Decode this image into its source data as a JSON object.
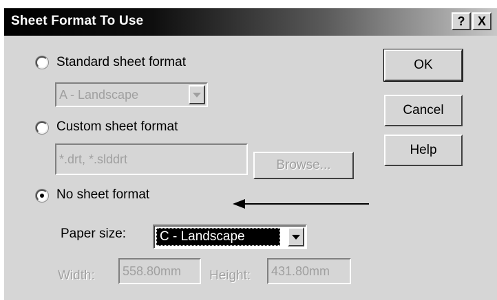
{
  "dialog": {
    "title": "Sheet Format To Use",
    "help_button_label": "?",
    "close_button_label": "X"
  },
  "options": {
    "standard": {
      "label": "Standard sheet format",
      "selected": false,
      "dropdown_value": "A - Landscape"
    },
    "custom": {
      "label": "Custom sheet format",
      "selected": false,
      "file_value": "*.drt, *.slddrt",
      "browse_label": "Browse..."
    },
    "none": {
      "label": "No sheet format",
      "selected": true
    }
  },
  "paper": {
    "label": "Paper size:",
    "value": "C - Landscape"
  },
  "dimensions": {
    "width_label": "Width:",
    "width_value": "558.80mm",
    "height_label": "Height:",
    "height_value": "431.80mm"
  },
  "buttons": {
    "ok": "OK",
    "cancel": "Cancel",
    "help": "Help"
  }
}
